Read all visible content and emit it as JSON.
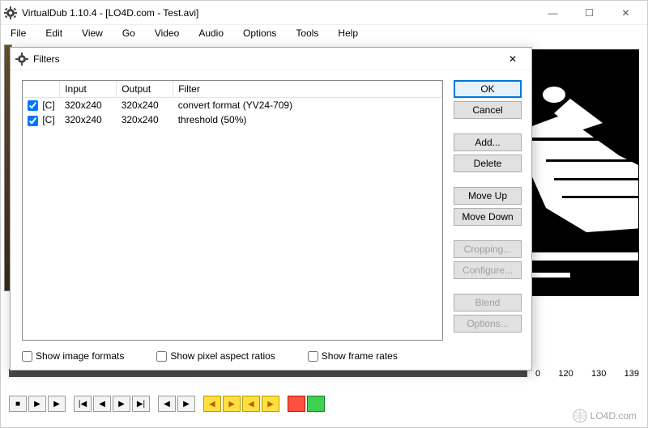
{
  "window": {
    "title": "VirtualDub 1.10.4 - [LO4D.com - Test.avi]",
    "buttons": {
      "min": "—",
      "max": "☐",
      "close": "✕"
    }
  },
  "menu": [
    "File",
    "Edit",
    "View",
    "Go",
    "Video",
    "Audio",
    "Options",
    "Tools",
    "Help"
  ],
  "dialog": {
    "title": "Filters",
    "close": "✕",
    "columns": [
      "",
      "Input",
      "Output",
      "Filter"
    ],
    "rows": [
      {
        "checked": true,
        "tag": "[C]",
        "input": "320x240",
        "output": "320x240",
        "filter": "convert format (YV24-709)"
      },
      {
        "checked": true,
        "tag": "[C]",
        "input": "320x240",
        "output": "320x240",
        "filter": "threshold (50%)"
      }
    ],
    "buttons": {
      "ok": "OK",
      "cancel": "Cancel",
      "add": "Add...",
      "delete": "Delete",
      "moveup": "Move Up",
      "movedown": "Move Down",
      "cropping": "Cropping...",
      "configure": "Configure...",
      "blend": "Blend",
      "options": "Options..."
    },
    "checks": {
      "image_formats": "Show image formats",
      "aspect_ratios": "Show pixel aspect ratios",
      "frame_rates": "Show frame rates"
    }
  },
  "timeline": {
    "ticks": [
      "0",
      "120",
      "130",
      "139"
    ]
  },
  "watermark": "LO4D.com"
}
